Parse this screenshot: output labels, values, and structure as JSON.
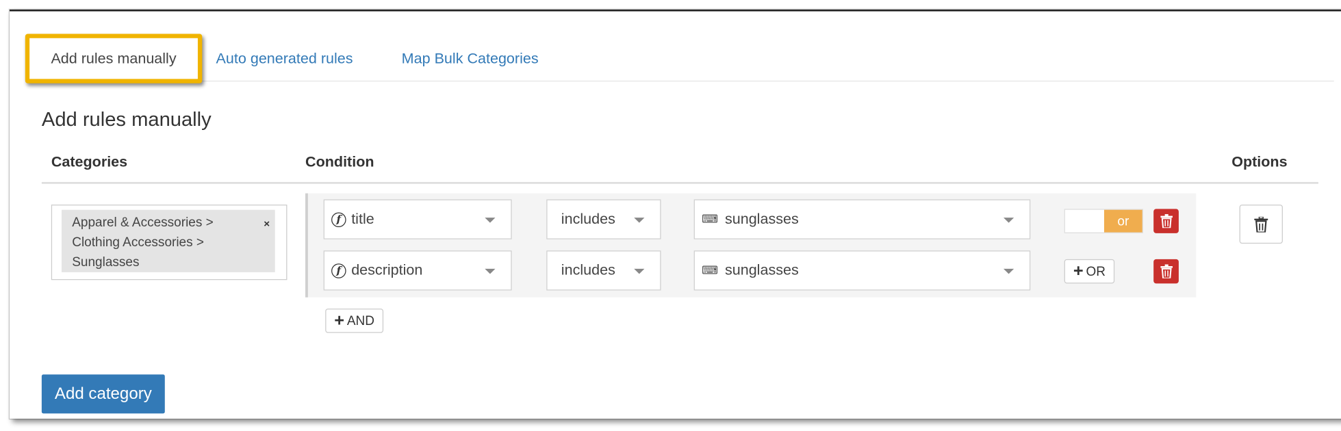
{
  "tabs": [
    {
      "label": "Add rules manually",
      "active": true
    },
    {
      "label": "Auto generated rules",
      "active": false
    },
    {
      "label": "Map Bulk Categories",
      "active": false
    }
  ],
  "section_title": "Add rules manually",
  "columns": {
    "categories": "Categories",
    "condition": "Condition",
    "options": "Options"
  },
  "category": {
    "lines": [
      "Apparel & Accessories >",
      "Clothing Accessories >",
      "Sunglasses"
    ],
    "remove_label": "×"
  },
  "conditions": [
    {
      "field": "title",
      "operator": "includes",
      "value": "sunglasses",
      "connector": "or"
    },
    {
      "field": "description",
      "operator": "includes",
      "value": "sunglasses",
      "add_or_label": "OR"
    }
  ],
  "add_and_label": "AND",
  "add_category_label": "Add category",
  "icons": {
    "field": "function-icon",
    "value": "keyboard-icon",
    "delete": "trash-icon"
  },
  "colors": {
    "accent": "#337ab7",
    "highlight": "#f0b400",
    "danger": "#c9302c",
    "toggle": "#f0ad4e"
  }
}
